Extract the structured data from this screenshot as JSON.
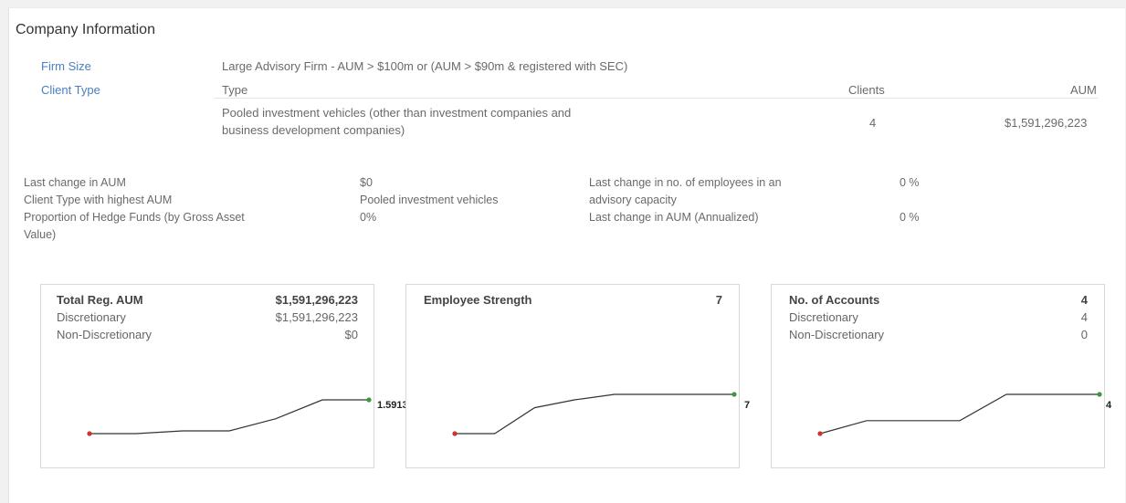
{
  "section_title": "Company Information",
  "firm_size": {
    "label": "Firm Size",
    "value": "Large Advisory Firm - AUM > $100m or (AUM > $90m & registered with SEC)"
  },
  "client_type": {
    "label": "Client Type",
    "col_type": "Type",
    "col_clients": "Clients",
    "col_aum": "AUM",
    "row": {
      "type_line1": "Pooled investment vehicles (other than investment companies and",
      "type_line2": "business development companies)",
      "clients": "4",
      "aum": "$1,591,296,223"
    }
  },
  "stats_left": [
    {
      "label": "Last change in AUM",
      "value": "$0"
    },
    {
      "label": "Client Type with highest AUM",
      "value": "Pooled investment vehicles"
    },
    {
      "label_line1": "Proportion of Hedge Funds (by Gross Asset",
      "label_line2": "Value)",
      "value": "0%"
    }
  ],
  "stats_right": [
    {
      "label_line1": "Last change in no. of employees in an",
      "label_line2": "advisory capacity",
      "value": "0 %"
    },
    {
      "label": "Last change in AUM (Annualized)",
      "value": "0 %"
    }
  ],
  "cards": [
    {
      "title": "Total Reg. AUM",
      "total": "$1,591,296,223",
      "row1_label": "Discretionary",
      "row1_value": "$1,591,296,223",
      "row2_label": "Non-Discretionary",
      "row2_value": "$0",
      "end_label": "1.5913",
      "trend": [
        0.0,
        0.0,
        0.07,
        0.07,
        0.38,
        0.86,
        0.86
      ]
    },
    {
      "title": "Employee Strength",
      "total": "7",
      "end_label": "7",
      "trend": [
        0.0,
        0.0,
        0.66,
        0.86,
        1.0,
        1.0,
        1.0,
        1.0
      ]
    },
    {
      "title": "No. of Accounts",
      "total": "4",
      "row1_label": "Discretionary",
      "row1_value": "4",
      "row2_label": "Non-Discretionary",
      "row2_value": "0",
      "end_label": "4",
      "trend": [
        0.0,
        0.33,
        0.33,
        0.33,
        1.0,
        1.0,
        1.0
      ]
    }
  ],
  "colors": {
    "label_blue": "#4a7fbf",
    "start_dot": "#cc3333",
    "end_dot": "#3a9a3a",
    "line": "#333333"
  }
}
